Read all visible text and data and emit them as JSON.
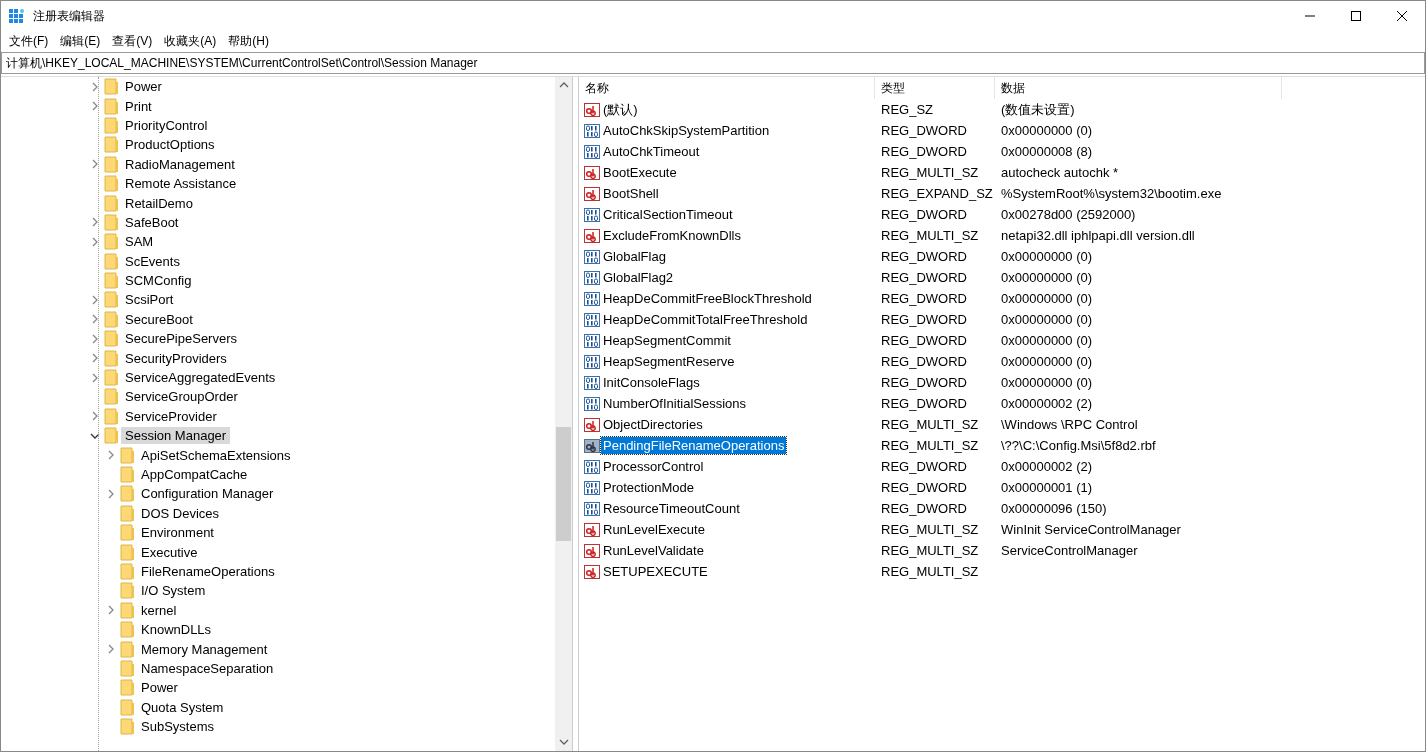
{
  "window": {
    "title": "注册表编辑器"
  },
  "menu": [
    "文件(F)",
    "编辑(E)",
    "查看(V)",
    "收藏夹(A)",
    "帮助(H)"
  ],
  "address": "计算机\\HKEY_LOCAL_MACHINE\\SYSTEM\\CurrentControlSet\\Control\\Session Manager",
  "tree": [
    {
      "label": "Power",
      "expanded": false,
      "selected": false
    },
    {
      "label": "Print",
      "expanded": false,
      "selected": false
    },
    {
      "label": "PriorityControl",
      "selected": false
    },
    {
      "label": "ProductOptions",
      "selected": false
    },
    {
      "label": "RadioManagement",
      "expanded": false,
      "selected": false
    },
    {
      "label": "Remote Assistance",
      "selected": false
    },
    {
      "label": "RetailDemo",
      "selected": false
    },
    {
      "label": "SafeBoot",
      "expanded": false,
      "selected": false
    },
    {
      "label": "SAM",
      "expanded": false,
      "selected": false
    },
    {
      "label": "ScEvents",
      "selected": false
    },
    {
      "label": "SCMConfig",
      "selected": false
    },
    {
      "label": "ScsiPort",
      "expanded": false,
      "selected": false
    },
    {
      "label": "SecureBoot",
      "expanded": false,
      "selected": false
    },
    {
      "label": "SecurePipeServers",
      "expanded": false,
      "selected": false
    },
    {
      "label": "SecurityProviders",
      "expanded": false,
      "selected": false
    },
    {
      "label": "ServiceAggregatedEvents",
      "expanded": false,
      "selected": false
    },
    {
      "label": "ServiceGroupOrder",
      "selected": false
    },
    {
      "label": "ServiceProvider",
      "expanded": false,
      "selected": false
    },
    {
      "label": "Session Manager",
      "expanded": true,
      "selected": true,
      "children": [
        {
          "label": "ApiSetSchemaExtensions",
          "expanded": false,
          "selected": false
        },
        {
          "label": "AppCompatCache",
          "selected": false
        },
        {
          "label": "Configuration Manager",
          "expanded": false,
          "selected": false
        },
        {
          "label": "DOS Devices",
          "selected": false
        },
        {
          "label": "Environment",
          "selected": false
        },
        {
          "label": "Executive",
          "selected": false
        },
        {
          "label": "FileRenameOperations",
          "selected": false
        },
        {
          "label": "I/O System",
          "selected": false
        },
        {
          "label": "kernel",
          "expanded": false,
          "selected": false
        },
        {
          "label": "KnownDLLs",
          "selected": false
        },
        {
          "label": "Memory Management",
          "expanded": false,
          "selected": false
        },
        {
          "label": "NamespaceSeparation",
          "selected": false
        },
        {
          "label": "Power",
          "selected": false
        },
        {
          "label": "Quota System",
          "selected": false
        },
        {
          "label": "SubSystems",
          "selected": false
        }
      ]
    }
  ],
  "table": {
    "columns": [
      "名称",
      "类型",
      "数据"
    ],
    "rows": [
      {
        "kind": "string",
        "name": "(默认)",
        "type": "REG_SZ",
        "data": "(数值未设置)",
        "selected": false
      },
      {
        "kind": "binary",
        "name": "AutoChkSkipSystemPartition",
        "type": "REG_DWORD",
        "data": "0x00000000 (0)",
        "selected": false
      },
      {
        "kind": "binary",
        "name": "AutoChkTimeout",
        "type": "REG_DWORD",
        "data": "0x00000008 (8)",
        "selected": false
      },
      {
        "kind": "string",
        "name": "BootExecute",
        "type": "REG_MULTI_SZ",
        "data": "autocheck autochk *",
        "selected": false
      },
      {
        "kind": "string",
        "name": "BootShell",
        "type": "REG_EXPAND_SZ",
        "data": "%SystemRoot%\\system32\\bootim.exe",
        "selected": false
      },
      {
        "kind": "binary",
        "name": "CriticalSectionTimeout",
        "type": "REG_DWORD",
        "data": "0x00278d00 (2592000)",
        "selected": false
      },
      {
        "kind": "string",
        "name": "ExcludeFromKnownDlls",
        "type": "REG_MULTI_SZ",
        "data": "netapi32.dll iphlpapi.dll version.dll",
        "selected": false
      },
      {
        "kind": "binary",
        "name": "GlobalFlag",
        "type": "REG_DWORD",
        "data": "0x00000000 (0)",
        "selected": false
      },
      {
        "kind": "binary",
        "name": "GlobalFlag2",
        "type": "REG_DWORD",
        "data": "0x00000000 (0)",
        "selected": false
      },
      {
        "kind": "binary",
        "name": "HeapDeCommitFreeBlockThreshold",
        "type": "REG_DWORD",
        "data": "0x00000000 (0)",
        "selected": false
      },
      {
        "kind": "binary",
        "name": "HeapDeCommitTotalFreeThreshold",
        "type": "REG_DWORD",
        "data": "0x00000000 (0)",
        "selected": false
      },
      {
        "kind": "binary",
        "name": "HeapSegmentCommit",
        "type": "REG_DWORD",
        "data": "0x00000000 (0)",
        "selected": false
      },
      {
        "kind": "binary",
        "name": "HeapSegmentReserve",
        "type": "REG_DWORD",
        "data": "0x00000000 (0)",
        "selected": false
      },
      {
        "kind": "binary",
        "name": "InitConsoleFlags",
        "type": "REG_DWORD",
        "data": "0x00000000 (0)",
        "selected": false
      },
      {
        "kind": "binary",
        "name": "NumberOfInitialSessions",
        "type": "REG_DWORD",
        "data": "0x00000002 (2)",
        "selected": false
      },
      {
        "kind": "string",
        "name": "ObjectDirectories",
        "type": "REG_MULTI_SZ",
        "data": "\\Windows \\RPC Control",
        "selected": false
      },
      {
        "kind": "string",
        "name": "PendingFileRenameOperations",
        "type": "REG_MULTI_SZ",
        "data": "\\??\\C:\\Config.Msi\\5f8d2.rbf",
        "selected": true
      },
      {
        "kind": "binary",
        "name": "ProcessorControl",
        "type": "REG_DWORD",
        "data": "0x00000002 (2)",
        "selected": false
      },
      {
        "kind": "binary",
        "name": "ProtectionMode",
        "type": "REG_DWORD",
        "data": "0x00000001 (1)",
        "selected": false
      },
      {
        "kind": "binary",
        "name": "ResourceTimeoutCount",
        "type": "REG_DWORD",
        "data": "0x00000096 (150)",
        "selected": false
      },
      {
        "kind": "string",
        "name": "RunLevelExecute",
        "type": "REG_MULTI_SZ",
        "data": "WinInit ServiceControlManager",
        "selected": false
      },
      {
        "kind": "string",
        "name": "RunLevelValidate",
        "type": "REG_MULTI_SZ",
        "data": "ServiceControlManager",
        "selected": false
      },
      {
        "kind": "string",
        "name": "SETUPEXECUTE",
        "type": "REG_MULTI_SZ",
        "selected": false
      }
    ]
  }
}
